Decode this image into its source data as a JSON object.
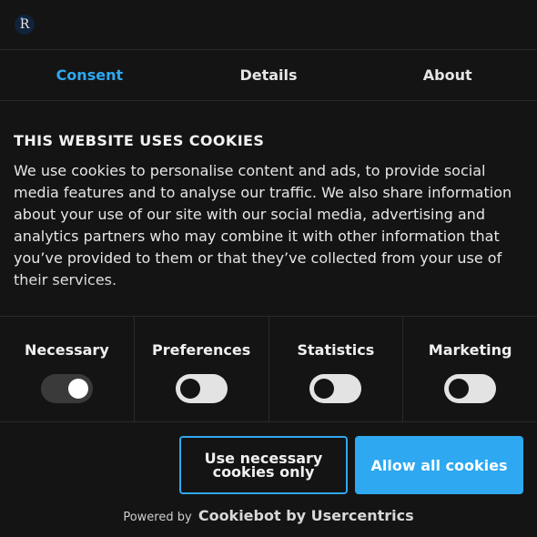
{
  "header": {
    "logo_letter": "R"
  },
  "tabs": [
    {
      "label": "Consent",
      "active": true
    },
    {
      "label": "Details",
      "active": false
    },
    {
      "label": "About",
      "active": false
    }
  ],
  "content": {
    "heading": "THIS WEBSITE USES COOKIES",
    "body": "We use cookies to personalise content and ads, to provide social media features and to analyse our traffic. We also share information about your use of our site with our social media, advertising and analytics partners who may combine it with other information that you’ve provided to them or that they’ve collected from your use of their services."
  },
  "toggles": [
    {
      "label": "Necessary",
      "on": true
    },
    {
      "label": "Preferences",
      "on": false
    },
    {
      "label": "Statistics",
      "on": false
    },
    {
      "label": "Marketing",
      "on": false
    }
  ],
  "buttons": {
    "necessary_only": "Use necessary cookies only",
    "allow_all": "Allow all cookies"
  },
  "footer": {
    "powered_by": "Powered by",
    "brand": "Cookiebot by Usercentrics"
  },
  "colors": {
    "accent": "#2ea8f0",
    "background": "#141414"
  }
}
